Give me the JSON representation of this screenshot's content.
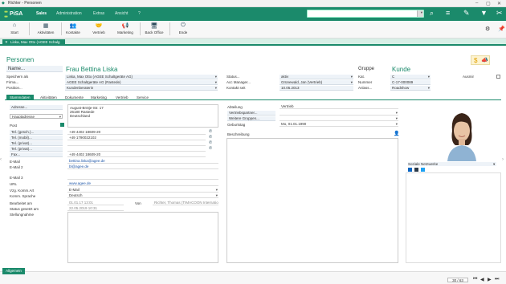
{
  "window": {
    "title": "Richter - Personen"
  },
  "topnav": {
    "logo": "PiSA",
    "items": [
      "Sales",
      "Administration",
      "Extras",
      "Ansicht",
      "?"
    ]
  },
  "toolbar": {
    "buttons": [
      "Start",
      "Aktivitäten",
      "Kontakte",
      "Vertrieb",
      "Marketing",
      "Back Office",
      "Ende"
    ]
  },
  "doctab": {
    "label": "Liska, Max Otto (AGEE Schalg"
  },
  "page": {
    "title": "Personen",
    "name_label": "Name...",
    "name_value": "Frau Bettina Liska",
    "gruppe_label": "Gruppe",
    "gruppe_value": "Kunde"
  },
  "left_fields": [
    {
      "label": "Speichern als",
      "value": "Liska, Max Otto (AGEE Schaltgeräte AG)"
    },
    {
      "label": "Firma...",
      "value": "AGEE Schaltgeräte AG (Rastede)"
    },
    {
      "label": "Position...",
      "value": "Kundenberaterin"
    }
  ],
  "mid_fields": [
    {
      "label": "Status...",
      "value": "aktiv"
    },
    {
      "label": "Acc Manager...",
      "value": "Grünewald, Jan (Vertrieb)"
    },
    {
      "label": "Kontakt seit",
      "value": "10.05.2013"
    }
  ],
  "right_fields": [
    {
      "label": "Kat.",
      "value": "C"
    },
    {
      "label": "Nummer",
      "value": "C-17-000089"
    },
    {
      "label": "Anlass...",
      "value": "Roadshow"
    }
  ],
  "ausmir": {
    "label": "Ausmir"
  },
  "subtabs": [
    "Stammdaten",
    "Aktivitäten",
    "Dokumente",
    "Marketing",
    "Vertrieb",
    "Service"
  ],
  "address": {
    "label": "Adresse...",
    "lines": [
      "August-Brötje-Str. 17",
      "26180 Rastede",
      "Deutschland"
    ],
    "type": "Hauptadresse",
    "post_label": "Post"
  },
  "contacts": [
    {
      "label": "Tel. (gesch.)...",
      "value": "+49 4402 18609-20",
      "phone": true
    },
    {
      "label": "Tel. (mobil)...",
      "value": "+49 1790022102",
      "phone": true
    },
    {
      "label": "Tel. (privat)...",
      "value": "",
      "phone": true
    },
    {
      "label": "Tel. (privat)...",
      "value": "",
      "phone": true
    },
    {
      "label": "Fax...",
      "value": "+49 4402 18609-20",
      "phone": false
    }
  ],
  "emails": [
    {
      "label": "E-Mail",
      "value": "bettina.liska@agee.de"
    },
    {
      "label": "E-Mail 2",
      "value": "bl@agee.de"
    },
    {
      "label": "E-Mail 3",
      "value": ""
    },
    {
      "label": "URL",
      "value": "www.agee.de"
    }
  ],
  "misc": [
    {
      "label": "Vzg. Komm.Art",
      "value": "E-Mail"
    },
    {
      "label": "Komm. Sprache",
      "value": "Deutsch"
    },
    {
      "label": "Bearbeitet am",
      "value": "01.01.17 13:01"
    },
    {
      "label": "Status gesetzt am",
      "value": "22.05.2019 10:31"
    },
    {
      "label": "Stellungnahme",
      "value": ""
    }
  ],
  "von": {
    "label": "Von",
    "value": "Richter, Thomas (TIMACOON Internation"
  },
  "right_panel": [
    {
      "label": "Abteilung",
      "value": "Vertrieb"
    },
    {
      "label": "Vertriebspartner...",
      "value": ""
    },
    {
      "label": "Weitere Gruppen...",
      "value": ""
    },
    {
      "label": "Geburtstag",
      "value": "Mo, 01.01.1990"
    }
  ],
  "beschreibung": {
    "label": "Beschreibung"
  },
  "social": {
    "label": "Soziale Netzwerke"
  },
  "bottom": {
    "tab": "Allgemein",
    "pager": "30 / 63"
  },
  "colors": {
    "brand": "#1b8a6b",
    "accent": "#b6e05a"
  }
}
